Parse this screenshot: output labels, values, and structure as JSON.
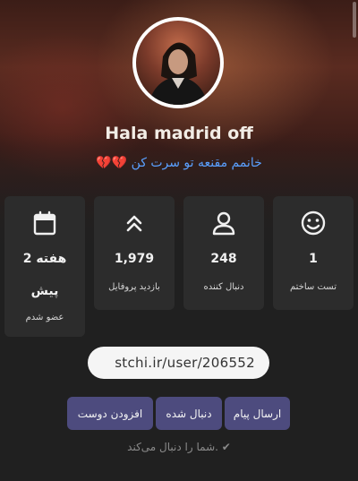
{
  "profile": {
    "name": "Hala madrid off",
    "bio_text": "خانمم مقنعه تو سرت کن",
    "bio_emoji": "💔💔"
  },
  "stats": [
    {
      "icon": "smile-icon",
      "value": "1",
      "label": "تست ساختم"
    },
    {
      "icon": "user-icon",
      "value": "248",
      "label": "دنبال کننده"
    },
    {
      "icon": "chevrons-up-icon",
      "value": "1,979",
      "label": "بازدید پروفایل"
    },
    {
      "icon": "calendar-icon",
      "value": "2 هفته",
      "value_line2": "پیش",
      "label": "عضو شدم"
    }
  ],
  "profile_url": "stchi.ir/user/206552",
  "actions": {
    "send_message": "ارسال پیام",
    "following": "دنبال شده",
    "add_friend": "افزودن دوست"
  },
  "follow_status": {
    "icon": "check-icon",
    "text": "شما را دنبال می‌کند."
  }
}
